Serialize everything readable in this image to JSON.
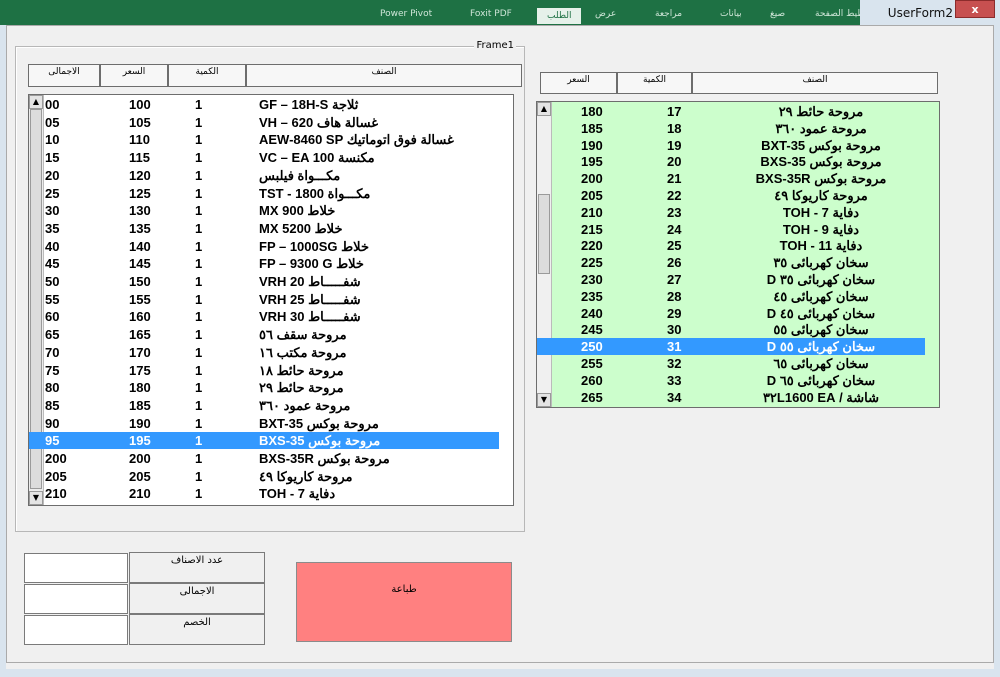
{
  "window": {
    "title": "UserForm2",
    "close_label": "x",
    "ribbon_tabs": [
      "Power Pivot",
      "Foxit PDF",
      "الطلب",
      "عرض",
      "مراجعة",
      "بيانات",
      "صيغ",
      "تخطيط الصفحة"
    ],
    "ribbon_active_index": 2
  },
  "frame": {
    "caption": "Frame1"
  },
  "left_headers": {
    "total": "الاجمالى",
    "price": "السعر",
    "qty": "الكمية",
    "name": "الصنف"
  },
  "right_headers": {
    "price": "السعر",
    "qty": "الكمية",
    "name": "الصنف"
  },
  "left_list": {
    "rows": [
      {
        "total": "00",
        "price": "100",
        "qty": "1",
        "name": "ثلاجة GF – 18H-S"
      },
      {
        "total": "05",
        "price": "105",
        "qty": "1",
        "name": "غسالة هاف VH – 620"
      },
      {
        "total": "10",
        "price": "110",
        "qty": "1",
        "name": "غسالة فوق اتوماتيك AEW-8460 SP"
      },
      {
        "total": "15",
        "price": "115",
        "qty": "1",
        "name": "مكنسة VC – EA 100"
      },
      {
        "total": "20",
        "price": "120",
        "qty": "1",
        "name": "مكـــواة فيلبس"
      },
      {
        "total": "25",
        "price": "125",
        "qty": "1",
        "name": "مكـــواة TST - 1800"
      },
      {
        "total": "30",
        "price": "130",
        "qty": "1",
        "name": "خلاط MX 900"
      },
      {
        "total": "35",
        "price": "135",
        "qty": "1",
        "name": "خلاط MX 5200"
      },
      {
        "total": "40",
        "price": "140",
        "qty": "1",
        "name": "خلاط FP – 1000SG"
      },
      {
        "total": "45",
        "price": "145",
        "qty": "1",
        "name": "خلاط FP – 9300 G"
      },
      {
        "total": "50",
        "price": "150",
        "qty": "1",
        "name": "شفـــــاط VRH 20"
      },
      {
        "total": "55",
        "price": "155",
        "qty": "1",
        "name": "شفـــــاط VRH 25"
      },
      {
        "total": "60",
        "price": "160",
        "qty": "1",
        "name": "شفـــــاط VRH 30"
      },
      {
        "total": "65",
        "price": "165",
        "qty": "1",
        "name": "مروحة سقف ٥٦"
      },
      {
        "total": "70",
        "price": "170",
        "qty": "1",
        "name": "مروحة مكتب ١٦"
      },
      {
        "total": "75",
        "price": "175",
        "qty": "1",
        "name": "مروحة حائط ١٨"
      },
      {
        "total": "80",
        "price": "180",
        "qty": "1",
        "name": "مروحة حائط ٢٩"
      },
      {
        "total": "85",
        "price": "185",
        "qty": "1",
        "name": "مروحة عمود ٣٦٠"
      },
      {
        "total": "90",
        "price": "190",
        "qty": "1",
        "name": "مروحة بوكس BXT-35"
      },
      {
        "total": "95",
        "price": "195",
        "qty": "1",
        "name": "مروحة بوكس BXS-35"
      },
      {
        "total": "200",
        "price": "200",
        "qty": "1",
        "name": "مروحة بوكس BXS-35R"
      },
      {
        "total": "205",
        "price": "205",
        "qty": "1",
        "name": "مروحة كاريوكا ٤٩"
      },
      {
        "total": "210",
        "price": "210",
        "qty": "1",
        "name": "دفاية TOH - 7"
      }
    ],
    "selected_index": 19
  },
  "right_list": {
    "rows": [
      {
        "price": "180",
        "qty": "17",
        "name": "مروحة حائط ٢٩"
      },
      {
        "price": "185",
        "qty": "18",
        "name": "مروحة عمود ٣٦٠"
      },
      {
        "price": "190",
        "qty": "19",
        "name": "مروحة بوكس BXT-35"
      },
      {
        "price": "195",
        "qty": "20",
        "name": "مروحة بوكس BXS-35"
      },
      {
        "price": "200",
        "qty": "21",
        "name": "مروحة بوكس BXS-35R"
      },
      {
        "price": "205",
        "qty": "22",
        "name": "مروحة كاريوكا ٤٩"
      },
      {
        "price": "210",
        "qty": "23",
        "name": "دفاية TOH - 7"
      },
      {
        "price": "215",
        "qty": "24",
        "name": "دفاية TOH - 9"
      },
      {
        "price": "220",
        "qty": "25",
        "name": "دفاية TOH - 11"
      },
      {
        "price": "225",
        "qty": "26",
        "name": "سخان كهربائى ٣٥"
      },
      {
        "price": "230",
        "qty": "27",
        "name": "سخان كهربائى ٣٥ D"
      },
      {
        "price": "235",
        "qty": "28",
        "name": "سخان كهربائى ٤٥"
      },
      {
        "price": "240",
        "qty": "29",
        "name": "سخان كهربائى ٤٥ D"
      },
      {
        "price": "245",
        "qty": "30",
        "name": "سخان كهربائى ٥٥"
      },
      {
        "price": "250",
        "qty": "31",
        "name": "سخان كهربائى ٥٥ D"
      },
      {
        "price": "255",
        "qty": "32",
        "name": "سخان كهربائى ٦٥"
      },
      {
        "price": "260",
        "qty": "33",
        "name": "سخان كهربائى ٦٥ D"
      },
      {
        "price": "265",
        "qty": "34",
        "name": "شاشة / EA ٣٢L1600"
      }
    ],
    "selected_index": 14
  },
  "summary": {
    "count_label": "عدد الاصناف",
    "total_label": "الاجمالى",
    "discount_label": "الخصم",
    "count_value": "",
    "total_value": "",
    "discount_value": ""
  },
  "print_button": {
    "label": "طباعة"
  },
  "colors": {
    "title_bar": "#1e7144",
    "right_list_bg": "#ccfecc",
    "selection": "#3399ff",
    "print_button": "#ff8080"
  }
}
